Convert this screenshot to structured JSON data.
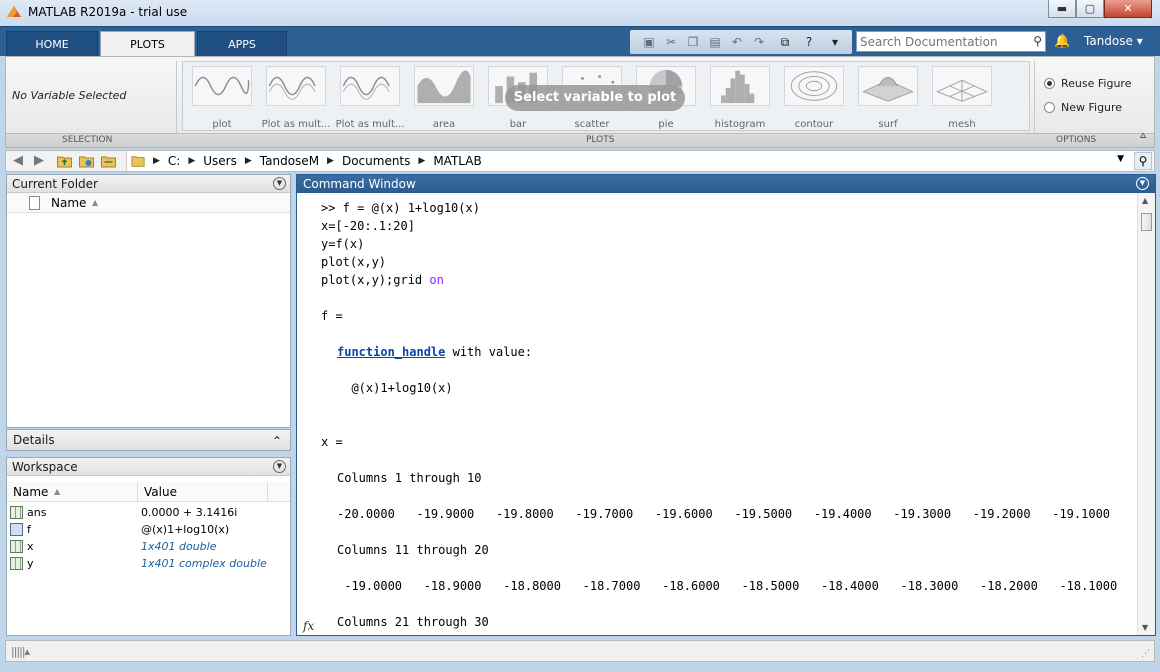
{
  "window": {
    "title": "MATLAB R2019a - trial use",
    "minimize": "▬",
    "maximize": "▢",
    "close": "✕"
  },
  "tabs": [
    "HOME",
    "PLOTS",
    "APPS"
  ],
  "active_tab": "PLOTS",
  "search": {
    "placeholder": "Search Documentation"
  },
  "user": {
    "name": "Tandose ▾"
  },
  "ribbon": {
    "selection_text": "No Variable Selected",
    "sections": {
      "selection": "SELECTION",
      "plots": "PLOTS",
      "options": "OPTIONS"
    },
    "gallery_overlay": "Select variable to plot",
    "gallery": [
      {
        "label": "plot",
        "icon": "plot-icon"
      },
      {
        "label": "Plot as mult...",
        "icon": "plot-multi-icon"
      },
      {
        "label": "Plot as mult...",
        "icon": "plot-multi-icon"
      },
      {
        "label": "area",
        "icon": "area-icon"
      },
      {
        "label": "bar",
        "icon": "bar-icon"
      },
      {
        "label": "scatter",
        "icon": "scatter-icon"
      },
      {
        "label": "pie",
        "icon": "pie-icon"
      },
      {
        "label": "histogram",
        "icon": "histogram-icon"
      },
      {
        "label": "contour",
        "icon": "contour-icon"
      },
      {
        "label": "surf",
        "icon": "surf-icon"
      },
      {
        "label": "mesh",
        "icon": "mesh-icon"
      }
    ],
    "options": {
      "reuse_figure": "Reuse Figure",
      "new_figure": "New Figure"
    }
  },
  "address": {
    "path": [
      "C:",
      "Users",
      "TandoseM",
      "Documents",
      "MATLAB"
    ]
  },
  "current_folder": {
    "title": "Current Folder",
    "column_name": "Name"
  },
  "details": {
    "title": "Details"
  },
  "workspace": {
    "title": "Workspace",
    "columns": [
      "Name",
      "Value"
    ],
    "rows": [
      {
        "name": "ans",
        "value": "0.0000 + 3.1416i"
      },
      {
        "name": "f",
        "value": "@(x)1+log10(x)"
      },
      {
        "name": "x",
        "value": "1x401 double"
      },
      {
        "name": "y",
        "value": "1x401 complex double"
      }
    ]
  },
  "command_window": {
    "title": "Command Window",
    "lines": {
      "l1": ">> f = @(x) 1+log10(x)",
      "l2": "x=[-20:.1:20]",
      "l3": "y=f(x)",
      "l4": "plot(x,y)",
      "l5a": "plot(x,y);grid ",
      "l5b": "on",
      "l6": "f =",
      "l7a": "function_handle",
      "l7b": " with value:",
      "l8": "  @(x)1+log10(x)",
      "l9": "x =",
      "l10": "Columns 1 through 10",
      "l11": "-20.0000   -19.9000   -19.8000   -19.7000   -19.6000   -19.5000   -19.4000   -19.3000   -19.2000   -19.1000",
      "l12": "Columns 11 through 20",
      "l13": " -19.0000   -18.9000   -18.8000   -18.7000   -18.6000   -18.5000   -18.4000   -18.3000   -18.2000   -18.1000",
      "l14": "Columns 21 through 30"
    },
    "fx": "fx"
  }
}
